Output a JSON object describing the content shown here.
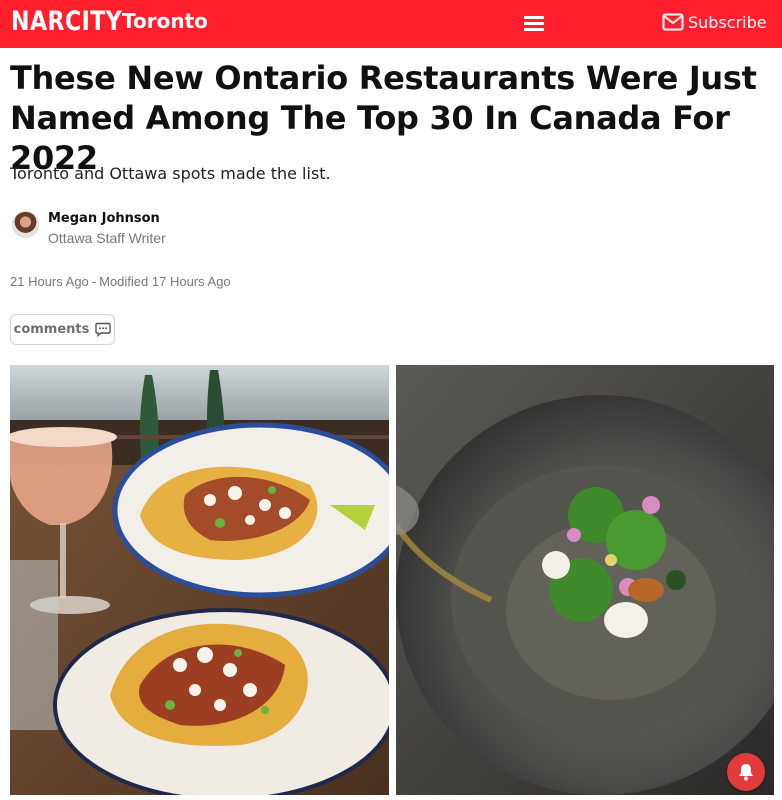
{
  "header": {
    "brand": "NARCITY",
    "city": "Toronto",
    "subscribe_label": "Subscribe"
  },
  "article": {
    "title": "These New Ontario Restaurants Were Just Named Among The Top 30 In Canada For 2022",
    "subtitle": "Toronto and Ottawa spots made the list.",
    "author": {
      "name": "Megan Johnson",
      "role": "Ottawa Staff Writer"
    },
    "published": "21 Hours Ago",
    "separator": "-",
    "modified": "Modified 17 Hours Ago",
    "comments_label": "comments"
  },
  "colors": {
    "brand_red": "#ff1f2d",
    "notification_red": "#e23b3b"
  },
  "icons": [
    "hamburger-menu-icon",
    "mail-icon",
    "comment-icon",
    "bell-icon"
  ]
}
